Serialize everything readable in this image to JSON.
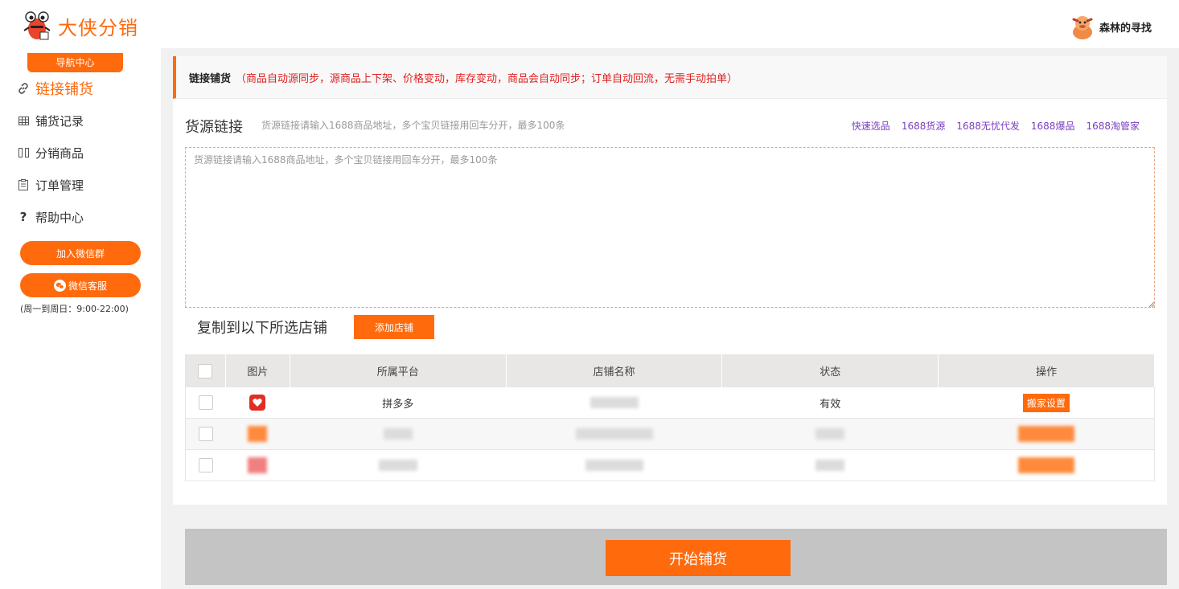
{
  "header": {
    "brand": "大侠分销",
    "user_name": "森林的寻找",
    "accent": "#ff6a0d"
  },
  "sidebar": {
    "nav_center": "导航中心",
    "items": [
      {
        "label": "链接铺货",
        "icon": "link-icon",
        "active": true
      },
      {
        "label": "铺货记录",
        "icon": "table-icon",
        "active": false
      },
      {
        "label": "分销商品",
        "icon": "columns-icon",
        "active": false
      },
      {
        "label": "订单管理",
        "icon": "clipboard-icon",
        "active": false
      },
      {
        "label": "帮助中心",
        "icon": "question-icon",
        "active": false
      }
    ],
    "wechat_group_btn": "加入微信群",
    "wechat_service_btn": "微信客服",
    "service_hours": "(周一到周日：9:00-22:00)"
  },
  "main": {
    "section_title": "链接铺货",
    "section_note": "（商品自动源同步，源商品上下架、价格变动，库存变动，商品会自动同步；订单自动回流，无需手动拍单）",
    "source_title": "货源链接",
    "source_hint": "货源链接请输入1688商品地址，多个宝贝链接用回车分开，最多100条",
    "source_placeholder": "货源链接请输入1688商品地址，多个宝贝链接用回车分开，最多100条",
    "quick_links": [
      "快速选品",
      "1688货源",
      "1688无忧代发",
      "1688爆品",
      "1688淘管家"
    ],
    "copy_title": "复制到以下所选店铺",
    "add_store_btn": "添加店铺",
    "table": {
      "headers": [
        "图片",
        "所属平台",
        "店铺名称",
        "状态",
        "操作"
      ],
      "rows": [
        {
          "platform": "拼多多",
          "status": "有效",
          "action": "搬家设置"
        }
      ]
    },
    "start_btn": "开始铺货"
  }
}
